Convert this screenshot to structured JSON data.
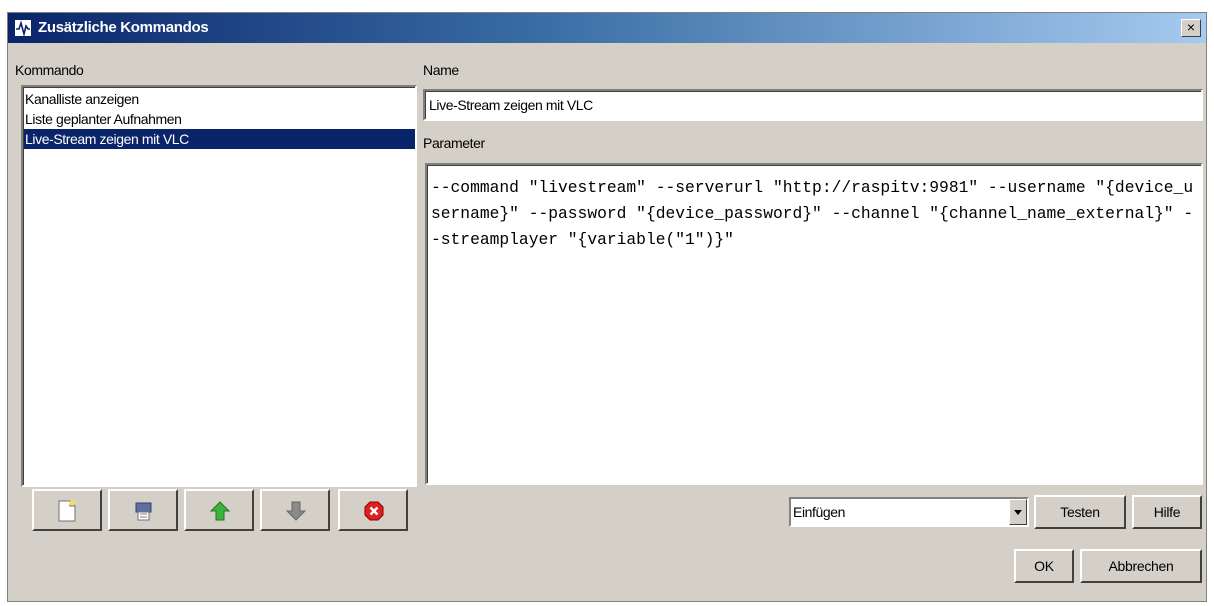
{
  "window": {
    "title": "Zusätzliche Kommandos",
    "close_label": "×"
  },
  "labels": {
    "kommando": "Kommando",
    "name": "Name",
    "parameter": "Parameter"
  },
  "commands": [
    {
      "label": "Kanalliste anzeigen",
      "selected": false
    },
    {
      "label": "Liste geplanter Aufnahmen",
      "selected": false
    },
    {
      "label": "Live-Stream zeigen mit VLC",
      "selected": true
    }
  ],
  "name_value": "Live-Stream zeigen mit VLC",
  "parameter_value": "--command \"livestream\" --serverurl \"http://raspitv:9981\" --username \"{device_username}\" --password \"{device_password}\" --channel \"{channel_name_external}\" --streamplayer \"{variable(\"1\")}\"",
  "toolbar_icons": [
    "new-document-icon",
    "copy-icon",
    "move-up-arrow-icon",
    "move-down-arrow-icon",
    "delete-icon"
  ],
  "insert_combo": {
    "selected": "Einfügen"
  },
  "buttons": {
    "test": "Testen",
    "help": "Hilfe",
    "ok": "OK",
    "cancel": "Abbrechen"
  },
  "colors": {
    "selection": "#0a246a",
    "title_start": "#0a246a",
    "title_end": "#a6caf0",
    "window_bg": "#d4d0c8",
    "arrow_up": "#3cb43c",
    "arrow_down": "#808080",
    "delete": "#e02020"
  }
}
